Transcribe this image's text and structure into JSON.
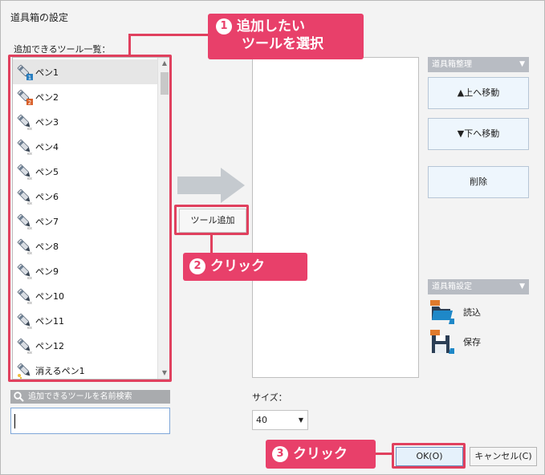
{
  "dialog": {
    "title": "道具箱の設定"
  },
  "tool_list": {
    "label": "追加できるツール一覧：",
    "items": [
      {
        "label": "ペン1",
        "badge": "1"
      },
      {
        "label": "ペン2",
        "badge": "2"
      },
      {
        "label": "ペン3",
        "badge": "ex"
      },
      {
        "label": "ペン4",
        "badge": "ex"
      },
      {
        "label": "ペン5",
        "badge": "ex"
      },
      {
        "label": "ペン6",
        "badge": "ex"
      },
      {
        "label": "ペン7",
        "badge": "ex"
      },
      {
        "label": "ペン8",
        "badge": "ex"
      },
      {
        "label": "ペン9",
        "badge": "ex"
      },
      {
        "label": "ペン10",
        "badge": "ex"
      },
      {
        "label": "ペン11",
        "badge": "ex"
      },
      {
        "label": "ペン12",
        "badge": "ex"
      },
      {
        "label": "消えるペン1",
        "badge": ""
      }
    ]
  },
  "add_button": {
    "label": "ツール追加"
  },
  "panels": {
    "manage": {
      "header": "道具箱整理",
      "move_up": "▲上へ移動",
      "move_down": "▼下へ移動",
      "delete": "削除"
    },
    "settings": {
      "header": "道具箱設定",
      "load": "読込",
      "save": "保存"
    }
  },
  "search": {
    "label": "追加できるツールを名前検索",
    "value": ""
  },
  "size": {
    "label": "サイズ：",
    "value": "40"
  },
  "footer": {
    "ok": "OK(O)",
    "cancel": "キャンセル(C)"
  },
  "callouts": {
    "step1_num": "1",
    "step1_line1": "追加したい",
    "step1_line2": "ツールを選択",
    "step2_num": "2",
    "step2_text": "クリック",
    "step3_num": "3",
    "step3_text": "クリック"
  },
  "colors": {
    "highlight": "#e0405e",
    "callout_bg": "#e8406a",
    "panel_header": "#b8bcc3",
    "side_button": "#eef6fd"
  }
}
